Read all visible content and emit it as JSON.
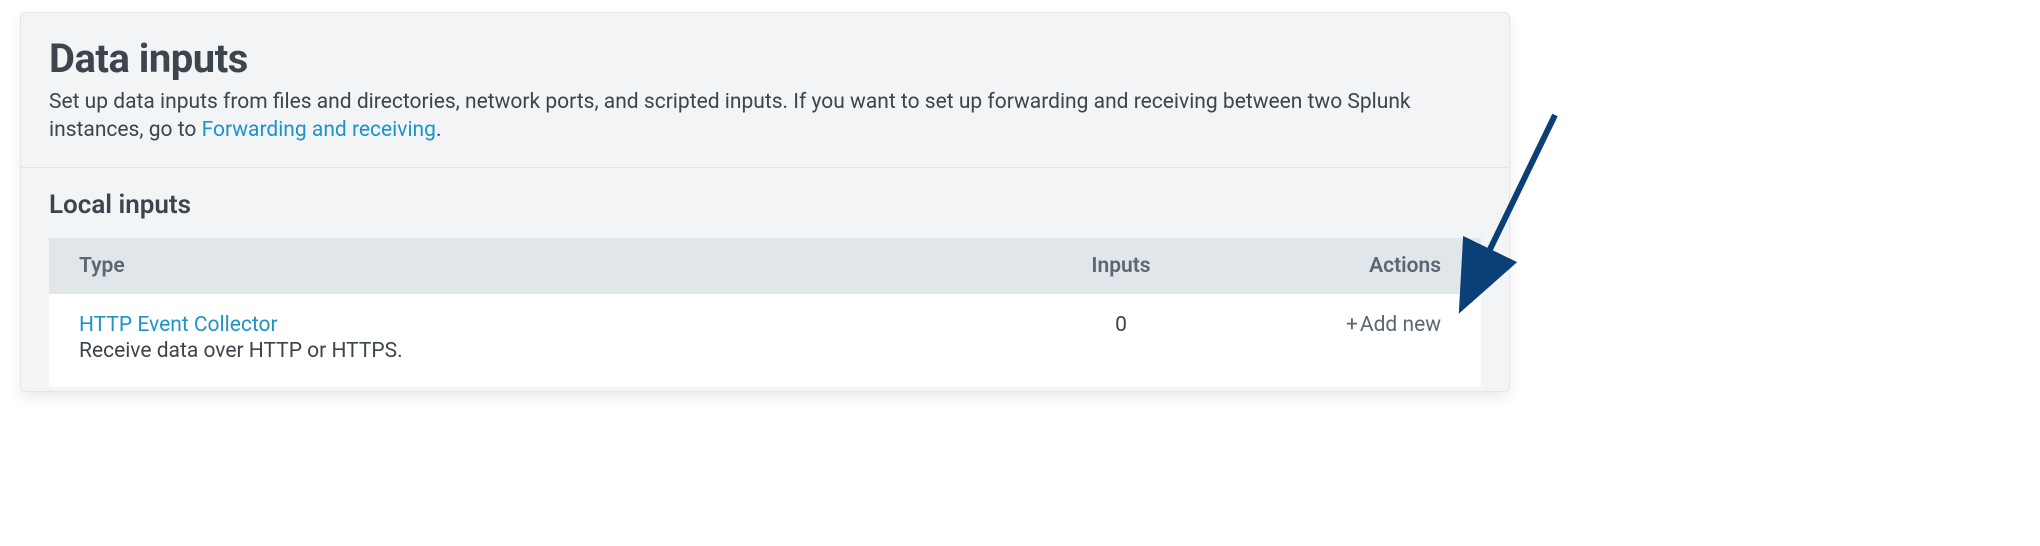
{
  "header": {
    "title": "Data inputs",
    "description_pre": "Set up data inputs from files and directories, network ports, and scripted inputs. If you want to set up forwarding and receiving between two Splunk instances, go to ",
    "description_link": "Forwarding and receiving",
    "description_post": "."
  },
  "section": {
    "title": "Local inputs"
  },
  "table": {
    "columns": {
      "type": "Type",
      "inputs": "Inputs",
      "actions": "Actions"
    },
    "rows": [
      {
        "type_name": "HTTP Event Collector",
        "type_desc": "Receive data over HTTP or HTTPS.",
        "inputs": "0",
        "action_label": "Add new",
        "action_plus": "+"
      }
    ]
  },
  "annotation": {
    "arrow_color": "#0b3f77"
  }
}
